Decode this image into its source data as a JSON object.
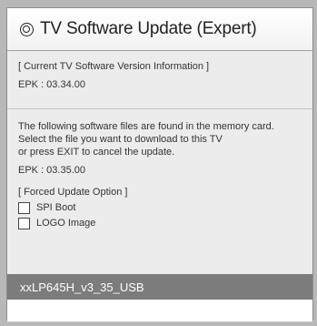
{
  "dialog": {
    "title": "TV Software Update (Expert)",
    "current_section_label": "[ Current TV Software Version Information ]",
    "current_version": "EPK : 03.34.00",
    "info_line1": "The following software files are found in the memory card.",
    "info_line2": "Select the file you want to download to this TV",
    "info_line3": "or press EXIT to cancel the update.",
    "new_version": "EPK : 03.35.00",
    "forced_option_label": "[ Forced Update Option ]",
    "options": [
      {
        "label": "SPI Boot",
        "checked": false
      },
      {
        "label": "LOGO Image",
        "checked": false
      }
    ],
    "files": [
      {
        "name": "xxLP645H_v3_35_USB",
        "selected": true
      }
    ]
  },
  "colors": {
    "background": "#b8b8b8",
    "panel": "#ececec",
    "selected_row": "#7c7c7c"
  }
}
